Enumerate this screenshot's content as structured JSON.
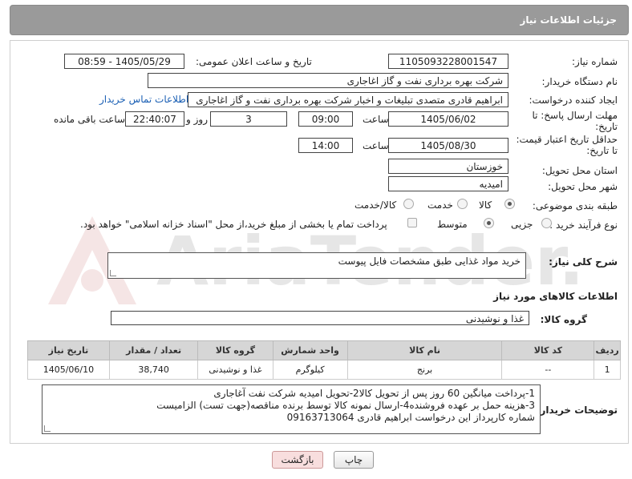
{
  "header": {
    "title": "جزئیات اطلاعات نیاز"
  },
  "watermark": {
    "text": "AriaTender.neT"
  },
  "fields": {
    "need_number_label": "شماره نیاز:",
    "need_number": "1105093228001547",
    "announce_label": "تاریخ و ساعت اعلان عمومی:",
    "announce_value": "1405/05/29 - 08:59",
    "buyer_org_label": "نام دستگاه خریدار:",
    "buyer_org": "شرکت بهره برداری نفت و گاز اغاجاری",
    "creator_label": "ایجاد کننده درخواست:",
    "creator": "ابراهیم قادری متصدی تبلیغات و اخبار شرکت بهره برداری نفت و گاز اغاجاری",
    "contact_link": "اطلاعات تماس خریدار",
    "deadline_label_1": "مهلت ارسال پاسخ: تا",
    "deadline_label_2": "تاریخ:",
    "deadline_date": "1405/06/02",
    "time_label": "ساعت",
    "deadline_time": "09:00",
    "days_value": "3",
    "days_label": "روز و",
    "remaining_time": "22:40:07",
    "remaining_label": "ساعت باقی مانده",
    "price_label_1": "حداقل تاریخ اعتبار قیمت:",
    "price_label_2": "تا تاریخ:",
    "price_date": "1405/08/30",
    "price_time": "14:00",
    "province_label": "استان محل تحویل:",
    "province": "خوزستان",
    "city_label": "شهر محل تحویل:",
    "city": "امیدیه",
    "category_label": "طبقه بندی موضوعی:",
    "category_options": [
      "کالا",
      "خدمت",
      "کالا/خدمت"
    ],
    "process_label": "نوع فرآیند خرید :",
    "process_options": [
      "جزیی",
      "متوسط"
    ],
    "payment_note": "پرداخت تمام یا بخشی از مبلغ خرید،از محل \"اسناد خزانه اسلامی\" خواهد بود.",
    "desc_label": "شرح کلی نیاز:",
    "desc_value": "خرید مواد غذایی طبق مشخصات فایل پیوست",
    "goods_info_title": "اطلاعات کالاهای مورد نیاز",
    "goods_group_label": "گروه کالا:",
    "goods_group": "غذا و نوشیدنی"
  },
  "table": {
    "headers": [
      "ردیف",
      "کد کالا",
      "نام کالا",
      "واحد شمارش",
      "گروه کالا",
      "تعداد / مقدار",
      "تاریخ نیاز"
    ],
    "rows": [
      [
        "1",
        "--",
        "برنج",
        "کیلوگرم",
        "غذا و نوشیدنی",
        "38,740",
        "1405/06/10"
      ]
    ]
  },
  "buyer_notes": {
    "label": "توضیحات خریدار:",
    "lines": [
      "1-پرداخت میانگین 60 روز پس از تحویل کالا2-تحویل امیدیه شرکت نفت آغاجاری",
      "3-هزینه حمل بر عهده فروشنده4-ارسال نمونه کالا توسط برنده مناقصه(جهت تست) الزامیست",
      "شماره کارپرداز این درخواست  ابراهیم قادری 09163713064"
    ]
  },
  "buttons": {
    "print": "چاپ",
    "back": "بازگشت"
  }
}
